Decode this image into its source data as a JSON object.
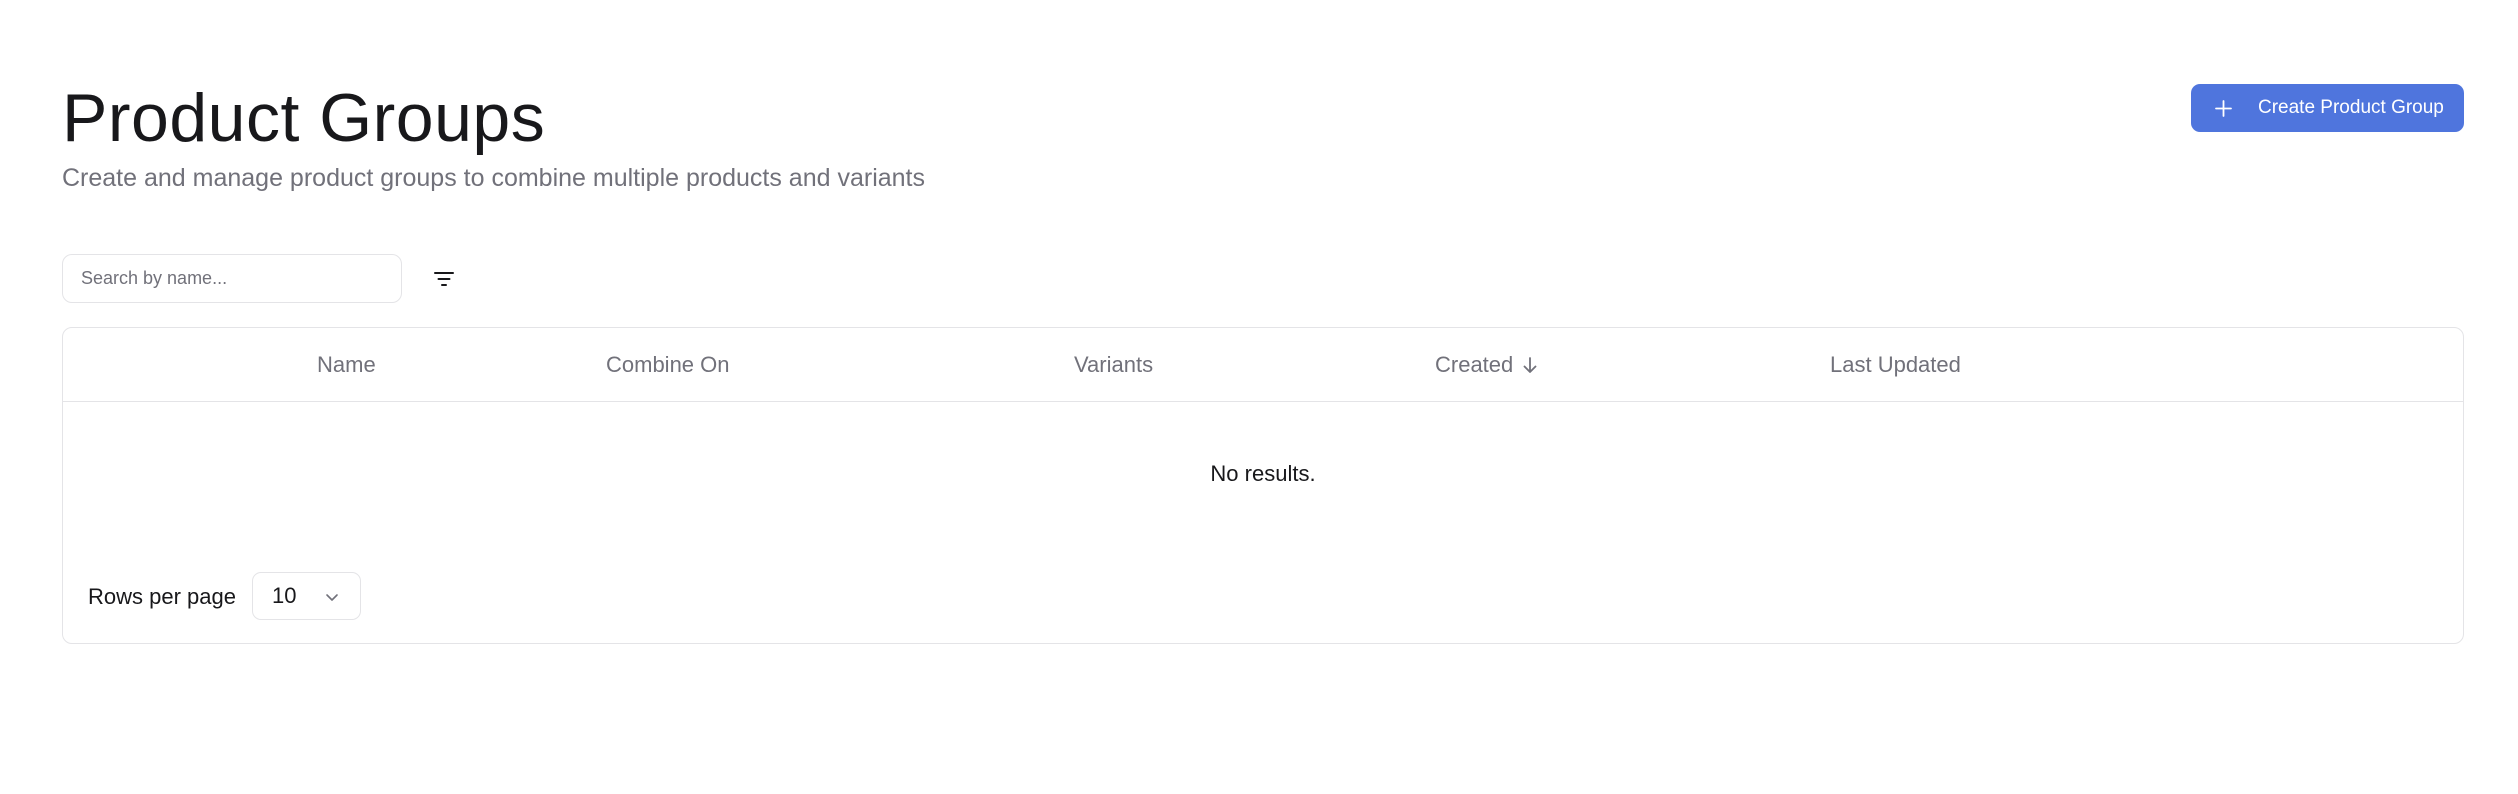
{
  "header": {
    "title": "Product Groups",
    "subtitle": "Create and manage product groups to combine multiple products and variants",
    "create_button_label": "Create Product Group"
  },
  "toolbar": {
    "search_placeholder": "Search by name...",
    "search_value": "",
    "filter_icon": "filter-icon"
  },
  "table": {
    "columns": [
      "Name",
      "Combine On",
      "Variants",
      "Created",
      "Last Updated"
    ],
    "sorted_column": "Created",
    "sort_direction": "desc",
    "rows": [],
    "empty_message": "No results."
  },
  "pagination": {
    "rows_per_page_label": "Rows per page",
    "rows_per_page_value": "10"
  },
  "colors": {
    "accent": "#4f75dd",
    "text_primary": "#18181b",
    "text_muted": "#71717a",
    "border": "#e4e4e7"
  }
}
